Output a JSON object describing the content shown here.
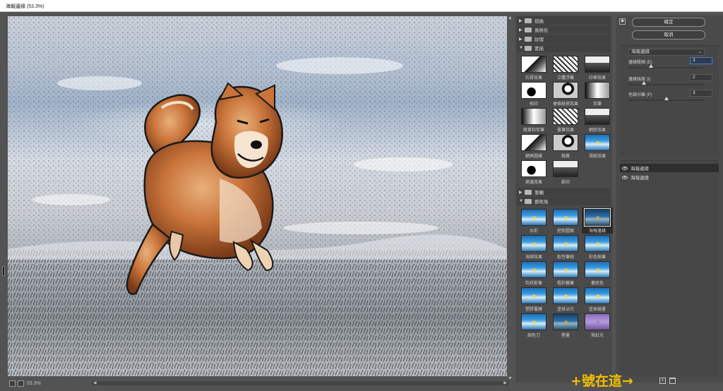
{
  "window": {
    "title": "海報邊緣 (53.3%)"
  },
  "preview": {
    "zoom_minus": "",
    "zoom_plus": "",
    "zoom_value": "53.3%"
  },
  "gallery": {
    "folders": [
      {
        "label": "扭曲",
        "expanded": false
      },
      {
        "label": "風格化",
        "expanded": false
      },
      {
        "label": "紋理",
        "expanded": false
      },
      {
        "label": "素描",
        "expanded": true
      },
      {
        "label": "筆觸",
        "expanded": false
      },
      {
        "label": "藝術風",
        "expanded": true
      }
    ],
    "sketch_filters": [
      "石膏效果",
      "立體浮雕",
      "印章效果",
      "拓印",
      "便條紙張效果",
      "炭筆",
      "鉻黃和炭筆",
      "畫筆效果",
      "網狀效果",
      "網屏圖樣",
      "鉻黃",
      "濕紙效果",
      "撕邊效果",
      "影印"
    ],
    "artistic_filters": [
      "水彩",
      "挖剪圖案",
      "海報邊緣",
      "海綿效果",
      "乾性筆刷",
      "彩色鉛筆",
      "粒狀影像",
      "粗彩蠟筆",
      "著底色",
      "塑膠覆膜",
      "塗抹沾污",
      "塗抹繪畫",
      "調色刀",
      "壁畫",
      "霓虹光"
    ],
    "selected_filter": "海報邊緣"
  },
  "settings": {
    "ok_label": "確定",
    "cancel_label": "取消",
    "filter_select": "海報邊緣",
    "params": [
      {
        "label": "邊緣粗細 (E)",
        "value": "3",
        "level": 0.3
      },
      {
        "label": "邊緣強度 (I)",
        "value": "2",
        "level": 0.2
      },
      {
        "label": "色調分離 (P)",
        "value": "3",
        "level": 0.5
      }
    ],
    "layers": [
      "海報邊緣",
      "海報邊緣"
    ]
  },
  "annotation": {
    "text": "+號在這→"
  }
}
